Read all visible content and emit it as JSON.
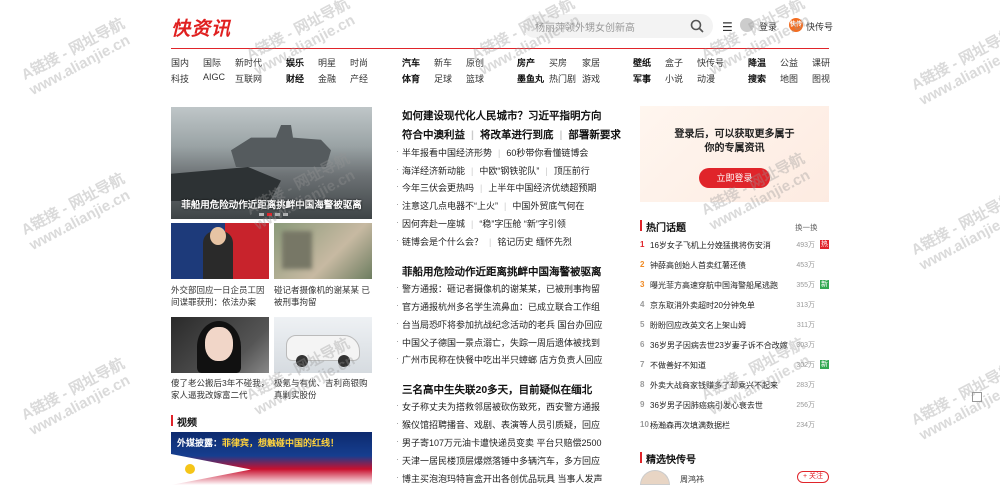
{
  "header": {
    "logo": "快资讯",
    "search_placeholder": "杨丽萍领外甥女创新高",
    "login_label": "登录",
    "kuaichuan_label": "快传号",
    "kuaichuan_badge": "快传"
  },
  "nav": [
    {
      "top": "国内",
      "bottom": "科技"
    },
    {
      "top": "国际",
      "bottom": "AIGC"
    },
    {
      "top": "新时代",
      "bottom": "互联网"
    },
    {
      "top": "娱乐",
      "bottom": "财经",
      "bold": true
    },
    {
      "top": "明星",
      "bottom": "金融"
    },
    {
      "top": "时尚",
      "bottom": "产经"
    },
    {
      "top": "汽车",
      "bottom": "体育",
      "bold": true
    },
    {
      "top": "新车",
      "bottom": "足球"
    },
    {
      "top": "原创",
      "bottom": "篮球"
    },
    {
      "top": "房产",
      "bottom": "墨鱼丸",
      "bold": true
    },
    {
      "top": "买房",
      "bottom": "热门剧"
    },
    {
      "top": "家居",
      "bottom": "游戏"
    },
    {
      "top": "壁纸",
      "bottom": "军事",
      "bold": true
    },
    {
      "top": "盒子",
      "bottom": "小说"
    },
    {
      "top": "快传号",
      "bottom": "动漫"
    },
    {
      "top": "降温",
      "bottom": "搜索",
      "bold": true
    },
    {
      "top": "公益",
      "bottom": "地图"
    },
    {
      "top": "课研",
      "bottom": "图视"
    }
  ],
  "left": {
    "hero_caption": "菲船用危险动作近距离挑衅中国海警被驱离",
    "thumbs": [
      {
        "caption": "外交部回应一日企员工因间谍罪获刑：依法办案"
      },
      {
        "caption": "碰记者摄像机的谢某某 已被刑事拘留"
      },
      {
        "caption": "傻了老公搬后3年不碰我，家人逼我改嫁富二代"
      },
      {
        "caption": "极氪与有优、吉利商银购真剿实股份"
      }
    ],
    "video_title": "视频",
    "video_overlay_prefix": "外媒披露：",
    "video_overlay_main": "菲律宾，想触碰中国的红线！"
  },
  "news": [
    {
      "text": "如何建设现代化人民城市？习近平指明方向",
      "big": true
    },
    {
      "text": "符合中澳利益",
      "text2": "将改革进行到底",
      "text3": "部署新要求",
      "big": true
    },
    {
      "text": "半年报看中国经济形势",
      "text2": "60秒带你看懂链博会"
    },
    {
      "text": "海洋经济新动能",
      "text2": "中欧“钢铁驼队”",
      "text3": "顶压前行"
    },
    {
      "text": "今年三伏会更热吗",
      "text2": "上半年中国经济优绩超预期"
    },
    {
      "text": "注意这几点电器不“上火”",
      "text2": "中国外贸底气何在"
    },
    {
      "text": "因何奔赴一座城",
      "text2": "“稳”字压舱 “新”字引领"
    },
    {
      "text": "链博会是个什么会？",
      "text2": "铭记历史 缅怀先烈"
    },
    {
      "text": "菲船用危险动作近距离挑衅中国海警被驱离",
      "big": true
    },
    {
      "text": "警方通报：砸记者摄像机的谢某某，已被刑事拘留"
    },
    {
      "text": "官方通报杭州多名学生流鼻血：已成立联合工作组"
    },
    {
      "text": "台当局恐吓将参加抗战纪念活动的老兵 国台办回应"
    },
    {
      "text": "中国父子德国一景点溺亡，失踪一周后遗体被找到"
    },
    {
      "text": "广州市民称在快餐中吃出半只蟑螂 店方负责人回应"
    },
    {
      "text": "三名高中生失联20多天，目前疑似在缅北",
      "big": true
    },
    {
      "text": "女子称丈夫为搭救邻居被砍伤致死，西安警方通报"
    },
    {
      "text": "猴仪馆招聘播音、戏剧、表演等人员引质疑，回应"
    },
    {
      "text": "男子寄107万元油卡遭快递员变卖 平台只赔偿2500"
    },
    {
      "text": "天津一居民楼顶层爆燃落锤中多辆汽车，多方回应"
    },
    {
      "text": "博主买泡泡玛特盲盒开出各创优品玩具 当事人发声"
    }
  ],
  "login_box": {
    "line1": "登录后，可以获取更多属于",
    "line2": "你的专属资讯",
    "button": "立即登录"
  },
  "hot": {
    "title": "热门话题",
    "refresh": "换一换",
    "items": [
      {
        "rank": "1",
        "text": "16岁女子飞机上分娩猛携将伤安消",
        "count": "493万",
        "badge": "热"
      },
      {
        "rank": "2",
        "text": "钟薛高创始人首卖红薯还债",
        "count": "453万",
        "badge": ""
      },
      {
        "rank": "3",
        "text": "曝光菲方高速穿航中国海警船尾逃跑",
        "count": "355万",
        "badge": "新"
      },
      {
        "rank": "4",
        "text": "京东取消外卖超时20分钟免单",
        "count": "313万",
        "badge": ""
      },
      {
        "rank": "5",
        "text": "盼盼回应改英文名上架山姆",
        "count": "311万",
        "badge": ""
      },
      {
        "rank": "6",
        "text": "36岁男子因病去世23岁妻子诉不合改嫁",
        "count": "303万",
        "badge": ""
      },
      {
        "rank": "7",
        "text": "不做善好不知道",
        "count": "302万",
        "badge": "新"
      },
      {
        "rank": "8",
        "text": "外卖大战商家钱赚多了却乘兴不起来",
        "count": "283万",
        "badge": ""
      },
      {
        "rank": "9",
        "text": "36岁男子因肺癌病引发心衰去世",
        "count": "256万",
        "badge": ""
      },
      {
        "rank": "10",
        "text": "杨瀚森再次填满数据栏",
        "count": "234万",
        "badge": ""
      }
    ]
  },
  "kuaichuan": {
    "title": "精选快传号",
    "author": "周鸿祎",
    "follow": "+ 关注"
  },
  "watermark": {
    "line1": "A链接 - 网址导航",
    "line2": "www.alianjie.cn"
  },
  "colors": {
    "brand_red": "#e0242a",
    "hot_orange": "#f08a24",
    "badge_green": "#33a852"
  }
}
